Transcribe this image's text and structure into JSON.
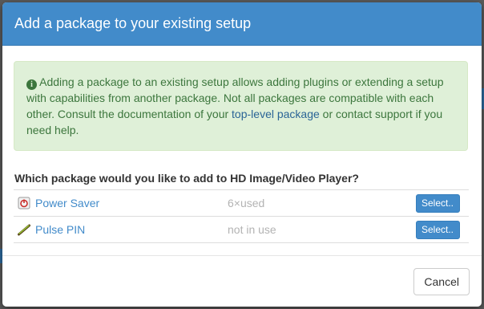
{
  "dialog": {
    "title": "Add a package to your existing setup"
  },
  "alert": {
    "text_before_link": "Adding a package to an existing setup allows adding plugins or extending a setup with capabilities from another package. Not all packages are compatible with each other. Consult the documentation of your ",
    "link_text": "top-level package",
    "text_after_link": " or contact support if you need help."
  },
  "question": "Which package would you like to add to HD Image/Video Player?",
  "packages": [
    {
      "name": "Power Saver",
      "usage": "6×used",
      "button": "Select..",
      "icon": "power-saver-icon"
    },
    {
      "name": "Pulse PIN",
      "usage": "not in use",
      "button": "Select..",
      "icon": "pulse-pin-icon"
    }
  ],
  "footer": {
    "cancel_label": "Cancel"
  },
  "colors": {
    "header": "#428bca",
    "alert_bg": "#dff0d8",
    "alert_text": "#3c763d",
    "link": "#428bca"
  }
}
